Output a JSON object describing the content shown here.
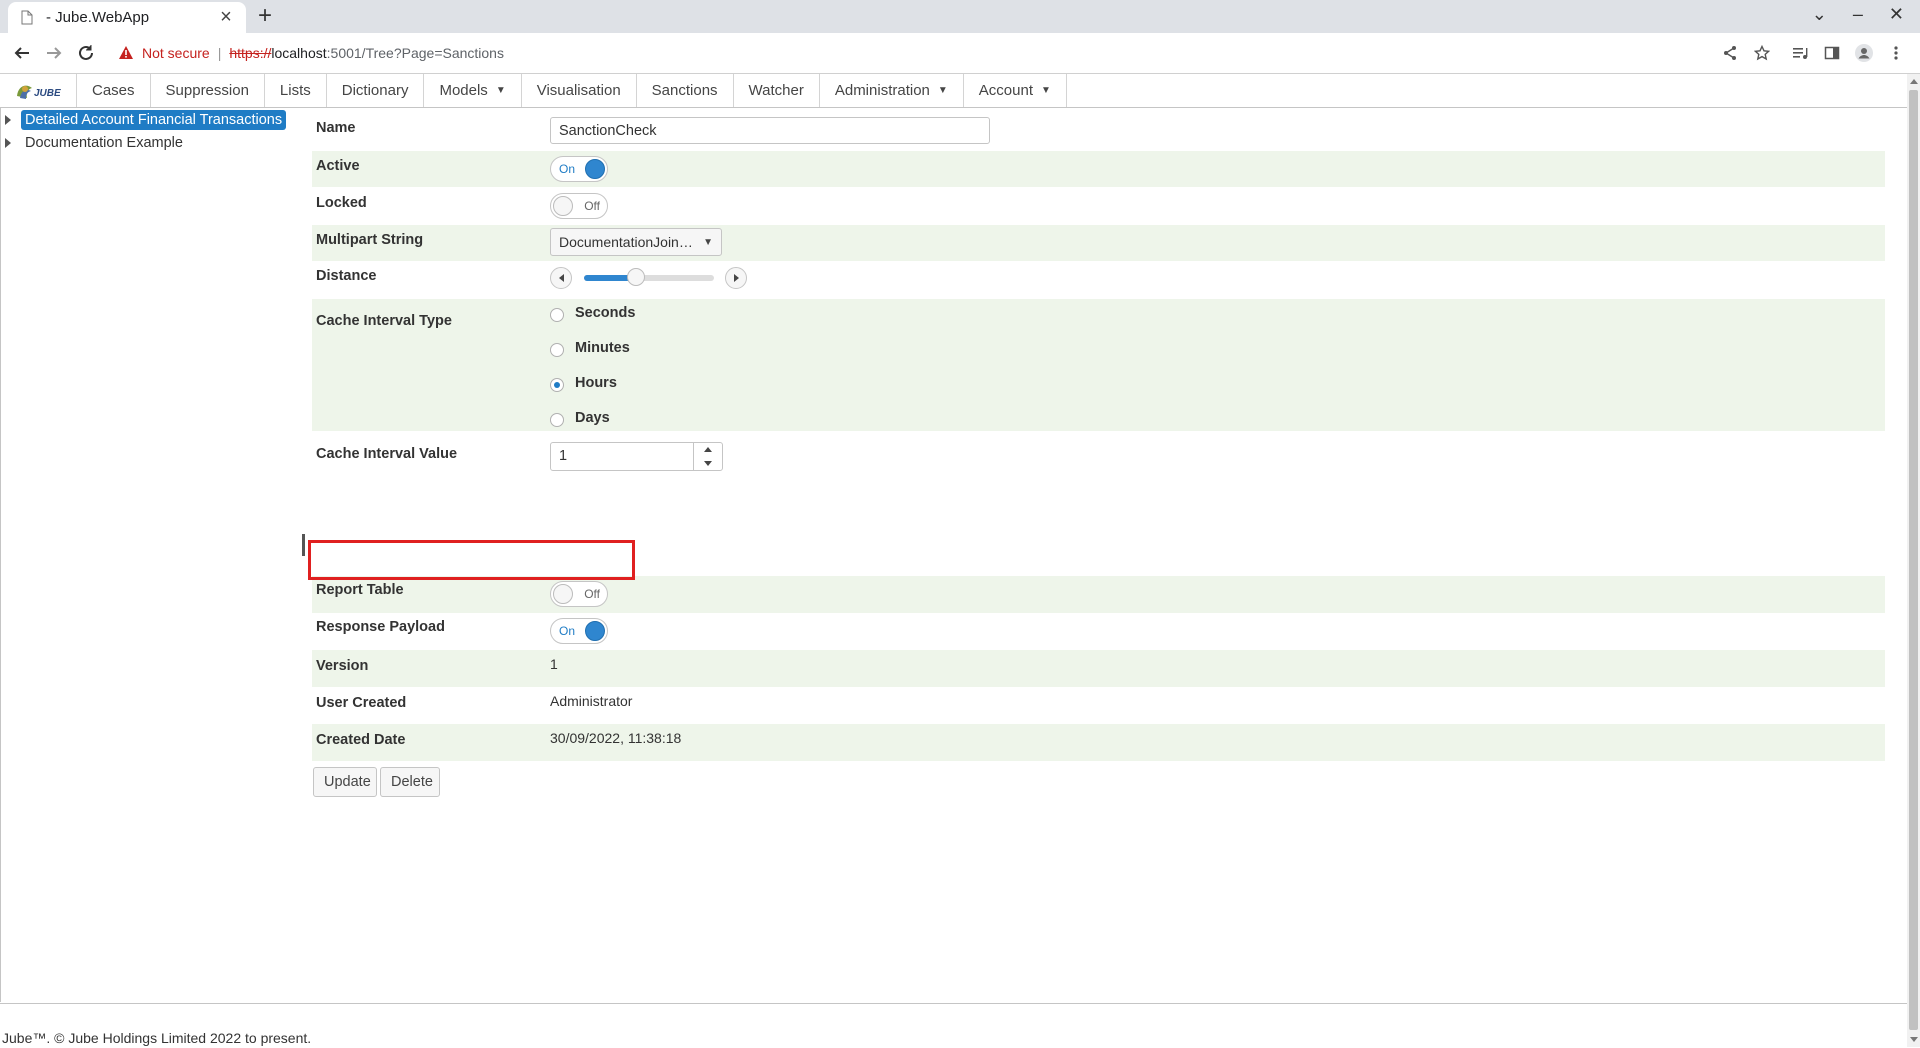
{
  "browser": {
    "tab_title": "- Jube.WebApp",
    "tab_close": "×",
    "new_tab": "+",
    "not_secure": "Not secure",
    "separator": "|",
    "url_scheme": "https://",
    "url_host": "localhost",
    "url_path": ":5001/Tree?Page=Sanctions",
    "window_controls": {
      "dropdown": "⌄",
      "minimize": "–",
      "close": "✕"
    }
  },
  "menu": {
    "items": [
      {
        "label": "Cases",
        "has_dropdown": false
      },
      {
        "label": "Suppression",
        "has_dropdown": false
      },
      {
        "label": "Lists",
        "has_dropdown": false
      },
      {
        "label": "Dictionary",
        "has_dropdown": false
      },
      {
        "label": "Models",
        "has_dropdown": true
      },
      {
        "label": "Visualisation",
        "has_dropdown": false
      },
      {
        "label": "Sanctions",
        "has_dropdown": false
      },
      {
        "label": "Watcher",
        "has_dropdown": false
      },
      {
        "label": "Administration",
        "has_dropdown": true
      },
      {
        "label": "Account",
        "has_dropdown": true
      }
    ],
    "caret": "▼"
  },
  "tree": {
    "nodes": [
      {
        "label": "Detailed Account Financial Transactions",
        "selected": true
      },
      {
        "label": "Documentation Example",
        "selected": false
      }
    ]
  },
  "form": {
    "name": {
      "label": "Name",
      "value": "SanctionCheck"
    },
    "active": {
      "label": "Active",
      "state": "On"
    },
    "locked": {
      "label": "Locked",
      "state": "Off"
    },
    "multipart_string": {
      "label": "Multipart String",
      "value": "DocumentationJoin…"
    },
    "distance": {
      "label": "Distance",
      "level_fraction": 0.4
    },
    "cache_interval_type": {
      "label": "Cache Interval Type",
      "options": [
        "Seconds",
        "Minutes",
        "Hours",
        "Days"
      ],
      "selected": "Hours"
    },
    "cache_interval_value": {
      "label": "Cache Interval Value",
      "value": "1"
    },
    "report_table": {
      "label": "Report Table",
      "state": "Off"
    },
    "response_payload": {
      "label": "Response Payload",
      "state": "On"
    },
    "version": {
      "label": "Version",
      "value": "1"
    },
    "user_created": {
      "label": "User Created",
      "value": "Administrator"
    },
    "created_date": {
      "label": "Created Date",
      "value": "30/09/2022, 11:38:18"
    }
  },
  "buttons": {
    "update": "Update",
    "delete": "Delete"
  },
  "footer": {
    "text": "Jube™. © Jube Holdings Limited 2022 to present."
  },
  "colors": {
    "accent": "#1f7cc5",
    "highlight": "#e02020",
    "row_alt": "#eef5ea"
  }
}
